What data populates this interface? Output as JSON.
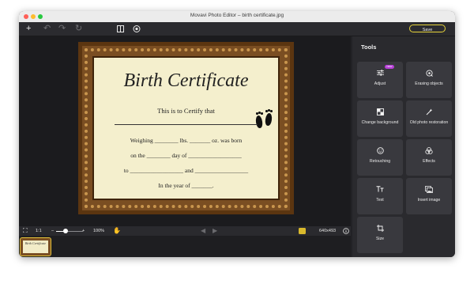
{
  "window": {
    "title": "Movavi Photo Editor – birth certificate.jpg"
  },
  "toolbar": {
    "save_label": "Save",
    "icons": [
      "plus-icon",
      "undo-icon",
      "redo-icon",
      "reset-icon",
      "compare-icon",
      "eye-icon"
    ]
  },
  "certificate": {
    "title": "Birth Certificate",
    "certify": "This is to Certify that",
    "line1": "Weighing ________ lbs. _______ oz. was born",
    "line2": "on the ________ day of __________________",
    "line3": "to __________________ and __________________",
    "line4": "In the year of _______."
  },
  "bottombar": {
    "ratio": "1:1",
    "minus": "–",
    "plus": "+",
    "zoom": "100%",
    "zoom_fraction": 0.35,
    "dimensions": "640x493"
  },
  "filmstrip": {
    "thumb_title": "Birth Certificate"
  },
  "panel": {
    "title": "Tools",
    "badge": "NEW",
    "tools": [
      {
        "label": "Adjust",
        "icon": "sliders-icon"
      },
      {
        "label": "Erasing objects",
        "icon": "eraser-icon"
      },
      {
        "label": "Change background",
        "icon": "background-icon"
      },
      {
        "label": "Old photo restoration",
        "icon": "restoration-icon"
      },
      {
        "label": "Retouching",
        "icon": "face-icon"
      },
      {
        "label": "Effects",
        "icon": "effects-icon"
      },
      {
        "label": "Text",
        "icon": "text-icon"
      },
      {
        "label": "Insert image",
        "icon": "insert-image-icon"
      },
      {
        "label": "Size",
        "icon": "crop-icon"
      }
    ]
  },
  "colors": {
    "accent": "#e5d23a",
    "badge": "#b63dd6",
    "panel": "#2a2a2e",
    "tile": "#39393e"
  }
}
